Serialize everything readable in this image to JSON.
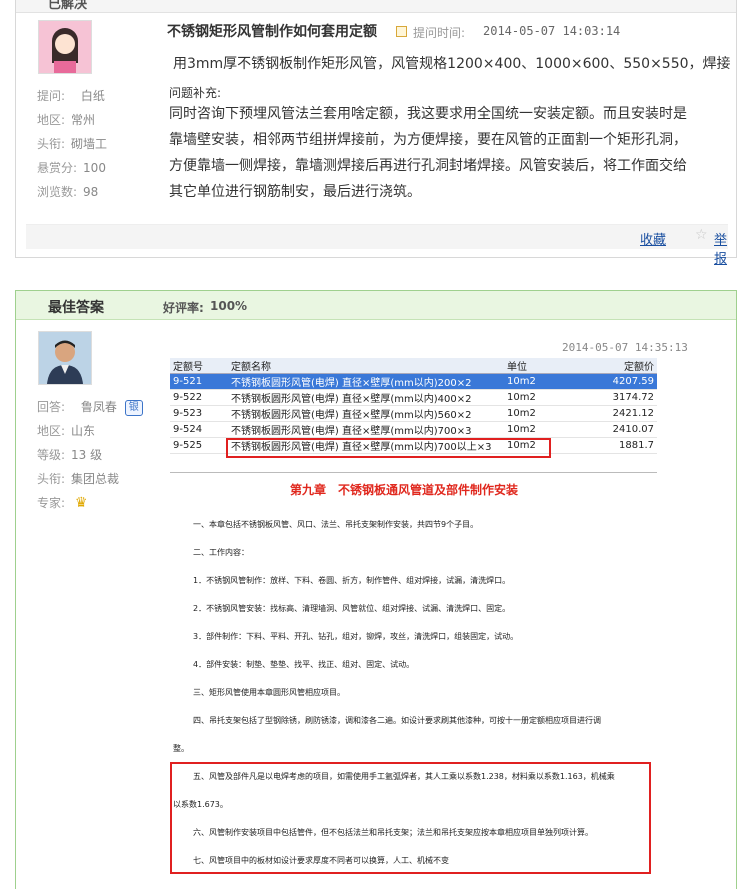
{
  "question": {
    "status_label": "已解决",
    "title": "不锈钢矩形风管制作如何套用定额",
    "time_label": "提问时间:",
    "time": "2014-05-07 14:03:14",
    "asker": {
      "label_asker": "提问:",
      "name": "白纸",
      "label_region": "地区:",
      "region": "常州",
      "label_title": "头衔:",
      "title": "砌墙工",
      "label_bounty": "悬赏分:",
      "bounty": "100",
      "label_views": "浏览数:",
      "views": "98"
    },
    "body_lines": [
      "用3mm厚不锈钢板制作矩形风管，风管规格1200×400、1000×600、550×550，焊接"
    ],
    "supplement_label": "问题补充:",
    "supplement_lines": [
      "同时咨询下预埋风管法兰套用啥定额，我这要求用全国统一安装定额。而且安装时是",
      "靠墙壁安装，相邻两节组拼焊接前，为方便焊接，要在风管的正面割一个矩形孔洞，",
      "方便靠墙一侧焊接，靠墙测焊接后再进行孔洞封堵焊接。风管安装后，将工作面交给",
      "其它单位进行钢筋制安，最后进行浇筑。"
    ],
    "favorite_label": "收藏",
    "report_label": "举报"
  },
  "answer": {
    "header_title": "最佳答案",
    "rate_label": "好评率:",
    "rate": "100%",
    "time": "2014-05-07 14:35:13",
    "answerer": {
      "label_answerer": "回答:",
      "name": "鲁凤春",
      "badge": "银",
      "label_region": "地区:",
      "region": "山东",
      "label_level": "等级:",
      "level": "13 级",
      "label_title": "头衔:",
      "title": "集团总裁",
      "label_expert": "专家:"
    },
    "table": {
      "headers": [
        "定额号",
        "定额名称",
        "单位",
        "定额价"
      ],
      "rows": [
        [
          "9-521",
          "不锈钢板圆形风管(电焊) 直径×壁厚(mm以内)200×2",
          "10m2",
          "4207.59"
        ],
        [
          "9-522",
          "不锈钢板圆形风管(电焊) 直径×壁厚(mm以内)400×2",
          "10m2",
          "3174.72"
        ],
        [
          "9-523",
          "不锈钢板圆形风管(电焊) 直径×壁厚(mm以内)560×2",
          "10m2",
          "2421.12"
        ],
        [
          "9-524",
          "不锈钢板圆形风管(电焊) 直径×壁厚(mm以内)700×3",
          "10m2",
          "2410.07"
        ],
        [
          "9-525",
          "不锈钢板圆形风管(电焊) 直径×壁厚(mm以内)700以上×3",
          "10m2",
          "1881.7"
        ]
      ]
    },
    "doc": {
      "heading": "第九章　不锈钢板通风管道及部件制作安装",
      "lines": [
        "一、本章包括不锈钢板风管、风口、法兰、吊托支架制作安装，共四节9个子目。",
        "二、工作内容：",
        "1．不锈钢风管制作：放样、下料、卷圆、折方，制作管件、组对焊接，试漏，清洗焊口。",
        "2．不锈钢风管安装：找标高、清理墙洞、风管就位、组对焊接、试漏、清洗焊口、固定。",
        "3．部件制作：下料、平料、开孔、钻孔，组对，铆焊，攻丝，清洗焊口，组装固定，试动。",
        "4．部件安装：制垫、垫垫、找平、找正、组对、固定、试动。",
        "三、矩形风管使用本章圆形风管相应项目。",
        "四、吊托支架包括了型钢除锈，刷防锈漆，调和漆各二遍。如设计要求刷其他漆种，可按十一册定额相应项目进行调",
        "整。",
        "五、风管及部件凡是以电焊考虑的项目，如需使用手工氩弧焊者，其人工乘以系数1.238，材料乘以系数1.163，机械乘",
        "以系数1.673。",
        "六、风管制作安装项目中包括管件，但不包括法兰和吊托支架；法兰和吊托支架应按本章相应项目单独列项计算。",
        "七、风管项目中的板材如设计要求厚度不同者可以换算，人工、机械不变"
      ]
    }
  }
}
